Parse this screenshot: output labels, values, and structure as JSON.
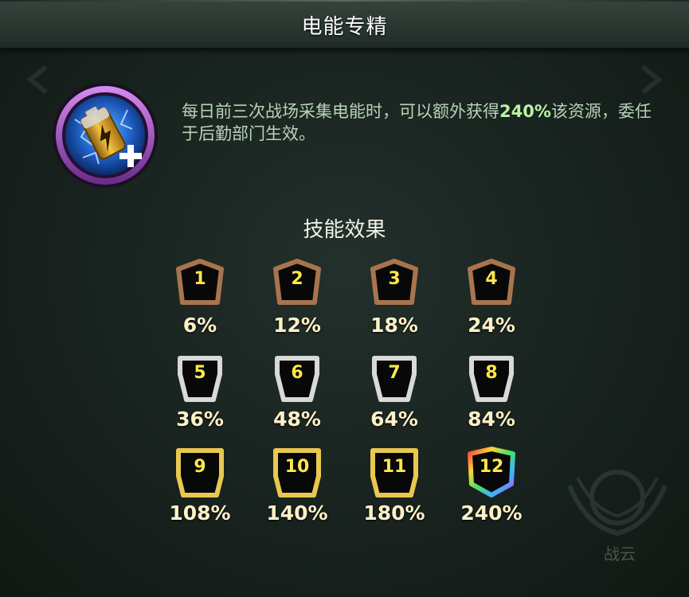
{
  "header": {
    "title": "电能专精"
  },
  "skill": {
    "icon": "battery-plus-icon",
    "description_before": "每日前三次战场采集电能时，可以额外获得",
    "description_highlight": "240%",
    "description_after": "该资源，委任于后勤部门生效。"
  },
  "effects": {
    "title": "技能效果",
    "levels": [
      {
        "level": "1",
        "value": "6%",
        "tier": "bronze"
      },
      {
        "level": "2",
        "value": "12%",
        "tier": "bronze"
      },
      {
        "level": "3",
        "value": "18%",
        "tier": "bronze"
      },
      {
        "level": "4",
        "value": "24%",
        "tier": "bronze"
      },
      {
        "level": "5",
        "value": "36%",
        "tier": "silver"
      },
      {
        "level": "6",
        "value": "48%",
        "tier": "silver"
      },
      {
        "level": "7",
        "value": "64%",
        "tier": "silver"
      },
      {
        "level": "8",
        "value": "84%",
        "tier": "silver"
      },
      {
        "level": "9",
        "value": "108%",
        "tier": "gold"
      },
      {
        "level": "10",
        "value": "140%",
        "tier": "gold"
      },
      {
        "level": "11",
        "value": "180%",
        "tier": "gold"
      },
      {
        "level": "12",
        "value": "240%",
        "tier": "rainbow"
      }
    ]
  },
  "background": {
    "emblem_text": "战云"
  },
  "colors": {
    "bronze": "#a8744e",
    "silver": "#d9d9d9",
    "gold": "#e8c850",
    "number": "#ffe64c",
    "highlight": "#b8f3a3"
  }
}
